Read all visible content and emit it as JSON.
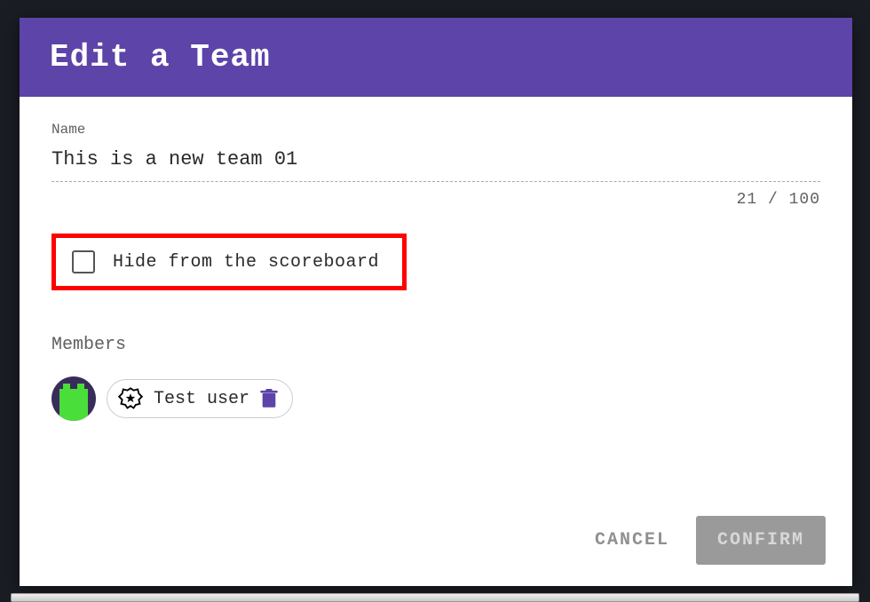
{
  "dialog": {
    "title": "Edit a Team",
    "name_label": "Name",
    "name_value": "This is a new team 01",
    "char_count": "21 / 100",
    "hide_label": "Hide from the scoreboard",
    "hide_checked": false,
    "members_label": "Members",
    "members": [
      {
        "name": "Test user"
      }
    ],
    "cancel_label": "CANCEL",
    "confirm_label": "CONFIRM"
  },
  "colors": {
    "header_bg": "#5c44a8",
    "highlight": "#ff0000",
    "trash": "#5c44a8"
  }
}
